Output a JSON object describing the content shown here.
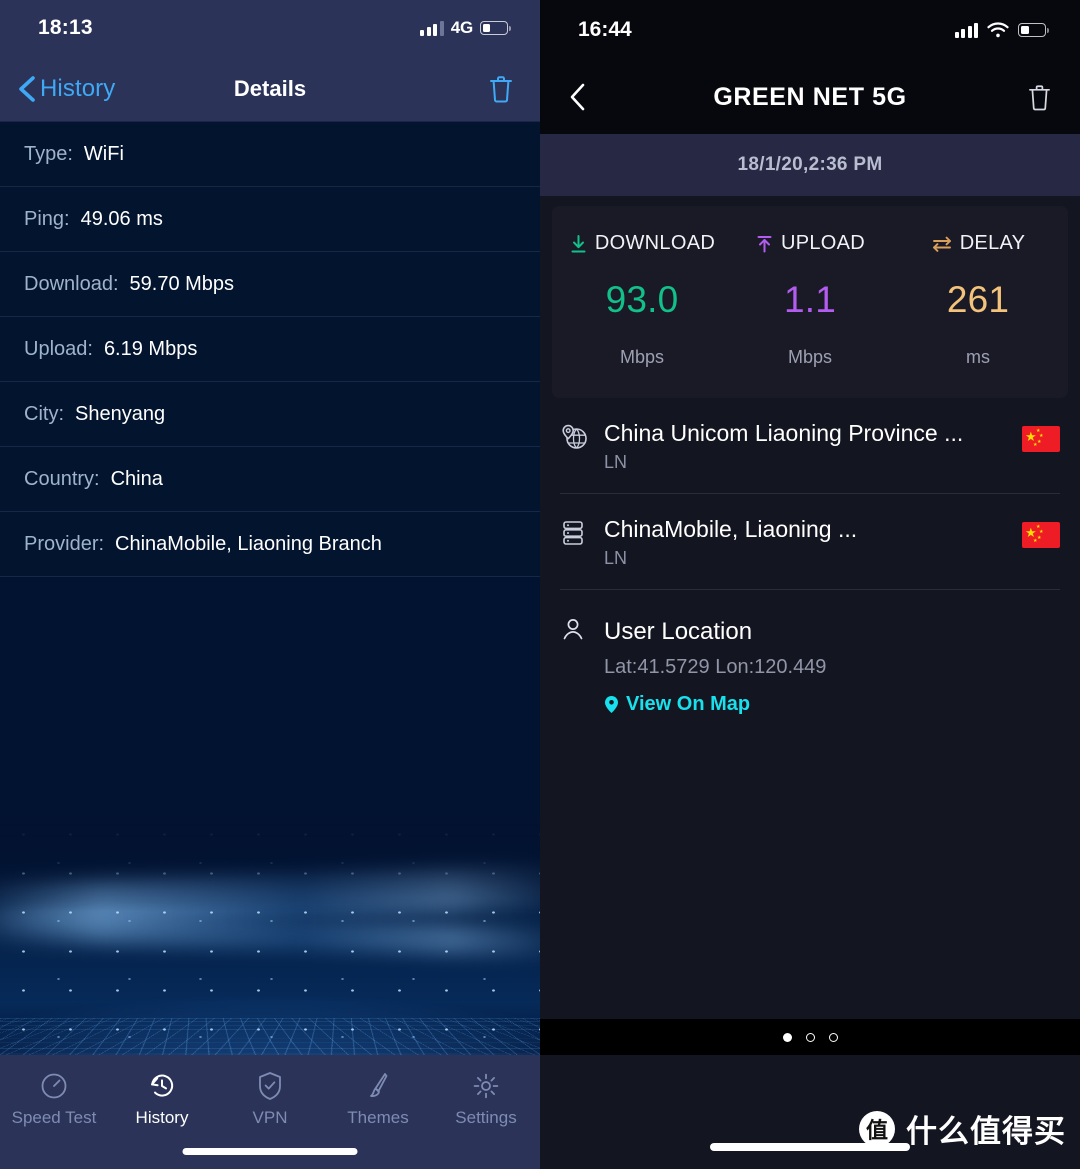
{
  "left": {
    "status": {
      "time": "18:13",
      "network": "4G",
      "battery_level": 32
    },
    "nav": {
      "back_label": "History",
      "title": "Details",
      "delete_icon": "trash-icon"
    },
    "details": [
      {
        "label": "Type:",
        "value": "WiFi"
      },
      {
        "label": "Ping:",
        "value": "49.06 ms"
      },
      {
        "label": "Download:",
        "value": "59.70 Mbps"
      },
      {
        "label": "Upload:",
        "value": "6.19 Mbps"
      },
      {
        "label": "City:",
        "value": "Shenyang"
      },
      {
        "label": "Country:",
        "value": "China"
      },
      {
        "label": "Provider:",
        "value": "ChinaMobile, Liaoning Branch"
      }
    ],
    "tabs": [
      {
        "label": "Speed Test",
        "icon": "speedometer-icon",
        "active": false
      },
      {
        "label": "History",
        "icon": "history-clock-icon",
        "active": true
      },
      {
        "label": "VPN",
        "icon": "shield-check-icon",
        "active": false
      },
      {
        "label": "Themes",
        "icon": "paintbrush-icon",
        "active": false
      },
      {
        "label": "Settings",
        "icon": "gear-icon",
        "active": false
      }
    ],
    "colors": {
      "bg": "#011331",
      "bar": "#2b3358",
      "accent": "#3fa9f5",
      "label": "#9fb3cd"
    }
  },
  "right": {
    "status": {
      "time": "16:44",
      "wifi": true,
      "battery_level": 38
    },
    "nav": {
      "back_icon": "chevron-left-icon",
      "title": "GREEN NET 5G",
      "delete_icon": "trash-icon"
    },
    "date": "18/1/20,2:36 PM",
    "stats": [
      {
        "label": "DOWNLOAD",
        "icon": "download-arrow-icon",
        "value": "93.0",
        "unit": "Mbps",
        "color": "#12C08A"
      },
      {
        "label": "UPLOAD",
        "icon": "upload-arrow-icon",
        "value": "1.1",
        "unit": "Mbps",
        "color": "#B25CF0"
      },
      {
        "label": "DELAY",
        "icon": "exchange-arrows-icon",
        "value": "261",
        "unit": "ms",
        "color": "#F3C27B"
      }
    ],
    "servers": [
      {
        "icon": "globe-pin-icon",
        "name": "China Unicom Liaoning Province ...",
        "sub": "LN",
        "flag": "china-flag-icon"
      },
      {
        "icon": "server-stack-icon",
        "name": "ChinaMobile, Liaoning ...",
        "sub": "LN",
        "flag": "china-flag-icon"
      }
    ],
    "location": {
      "icon": "user-icon",
      "title": "User Location",
      "coords": "Lat:41.5729 Lon:120.449",
      "link_label": "View On Map",
      "link_icon": "map-pin-icon",
      "link_color": "#18E0EC"
    },
    "pager": {
      "total": 3,
      "active_index": 0
    },
    "colors": {
      "bg": "#131520",
      "bar": "#07080e",
      "card": "#1a1a26",
      "datebar": "#262844"
    }
  },
  "watermark": {
    "logo_char": "值",
    "text": "什么值得买"
  }
}
